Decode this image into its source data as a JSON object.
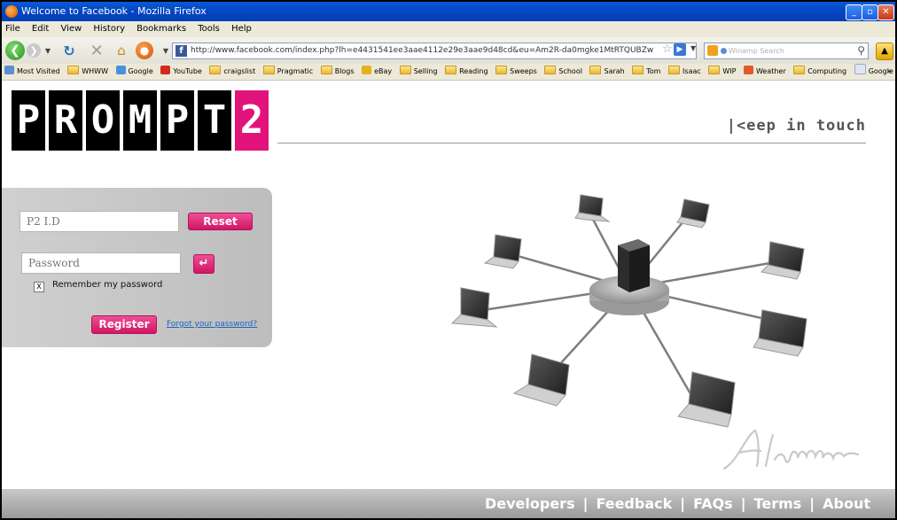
{
  "window": {
    "title": "Welcome to Facebook - Mozilla Firefox",
    "buttons": [
      "_",
      "▫",
      "✕"
    ]
  },
  "menu": [
    "File",
    "Edit",
    "View",
    "History",
    "Bookmarks",
    "Tools",
    "Help"
  ],
  "nav": {
    "url": "http://www.facebook.com/index.php?lh=e4431541ee3aae4112e29e3aae9d48cd&eu=Am2R-da0mgke1MtRTQUBZw",
    "search_placeholder": "Winamp Search"
  },
  "bookmarks": [
    "Most Visited",
    "WHWW",
    "Google",
    "YouTube",
    "craigslist",
    "Pragmatic",
    "Blogs",
    "eBay",
    "Selling",
    "Reading",
    "Sweeps",
    "School",
    "Sarah",
    "Tom",
    "Isaac",
    "WIP",
    "Weather",
    "Computing",
    "Google Bookmark"
  ],
  "page": {
    "logo_letters": [
      "P",
      "R",
      "O",
      "M",
      "P",
      "T",
      "2"
    ],
    "tagline": "|<eep in touch",
    "login": {
      "id_placeholder": "P2 I.D",
      "password_placeholder": "Password",
      "reset_label": "Reset",
      "enter_symbol": "↵",
      "remember_mark": "X",
      "remember_label": "Remember my password",
      "register_label": "Register",
      "forgot_label": "Forgot your password?"
    },
    "signature": "Alamene"
  },
  "footer": {
    "links": [
      "Developers",
      "Feedback",
      "FAQs",
      "Terms",
      "About"
    ]
  },
  "colors": {
    "accent_pink": "#e2137a",
    "titlebar_blue": "#0348c6",
    "link_blue": "#1a63c4"
  }
}
